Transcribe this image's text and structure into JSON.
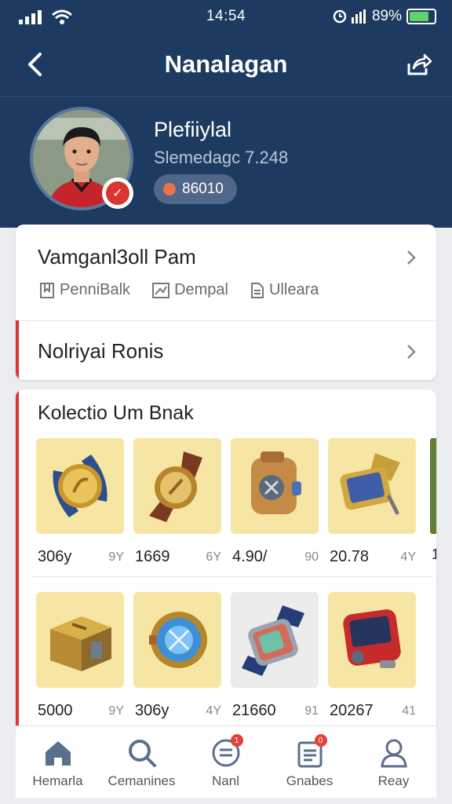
{
  "status_bar": {
    "time": "14:54",
    "battery_text": "89%"
  },
  "nav": {
    "title": "Nanalagan"
  },
  "profile": {
    "name": "Plefiiylal",
    "subtitle": "Slemedagc 7.248",
    "coins": "86010"
  },
  "section1": {
    "title": "Vamganl3oll Pam",
    "links": [
      "PenniBalk",
      "Dempal",
      "Ulleara"
    ],
    "row2_title": "Nolriyai Ronis"
  },
  "collection": {
    "title": "Kolectio Um Bnak",
    "items": [
      {
        "icon": "gold-watch-icon",
        "price": "306y",
        "count": "9Y",
        "bg": "#f7e6a3"
      },
      {
        "icon": "brown-watch-icon",
        "price": "1669",
        "count": "6Y",
        "bg": "#f7e6a3"
      },
      {
        "icon": "bronze-device-icon",
        "price": "4.90/",
        "count": "90",
        "bg": "#f7e6a3"
      },
      {
        "icon": "tablet-watch-icon",
        "price": "20.78",
        "count": "4Y",
        "bg": "#f7e6a3"
      },
      {
        "icon": "gold-chest-icon",
        "price": "5000",
        "count": "9Y",
        "bg": "#f7e6a3"
      },
      {
        "icon": "blue-dial-watch-icon",
        "price": "306y",
        "count": "4Y",
        "bg": "#f7e6a3"
      },
      {
        "icon": "holo-smartwatch-icon",
        "price": "21660",
        "count": "91",
        "bg": "#ececec"
      },
      {
        "icon": "red-device-icon",
        "price": "20267",
        "count": "41",
        "bg": "#f7e6a3"
      }
    ],
    "edge_value": "1"
  },
  "tabs": [
    {
      "label": "Hemarla",
      "icon": "home-icon",
      "badge": ""
    },
    {
      "label": "Cemanines",
      "icon": "search-icon",
      "badge": ""
    },
    {
      "label": "Nanl",
      "icon": "menu-circle-icon",
      "badge": "1"
    },
    {
      "label": "Gnabes",
      "icon": "clipboard-icon",
      "badge": "0"
    },
    {
      "label": "Reay",
      "icon": "user-icon",
      "badge": ""
    }
  ],
  "colors": {
    "header": "#1d3a60",
    "accent": "#d8362f",
    "tile": "#f7e6a3"
  }
}
